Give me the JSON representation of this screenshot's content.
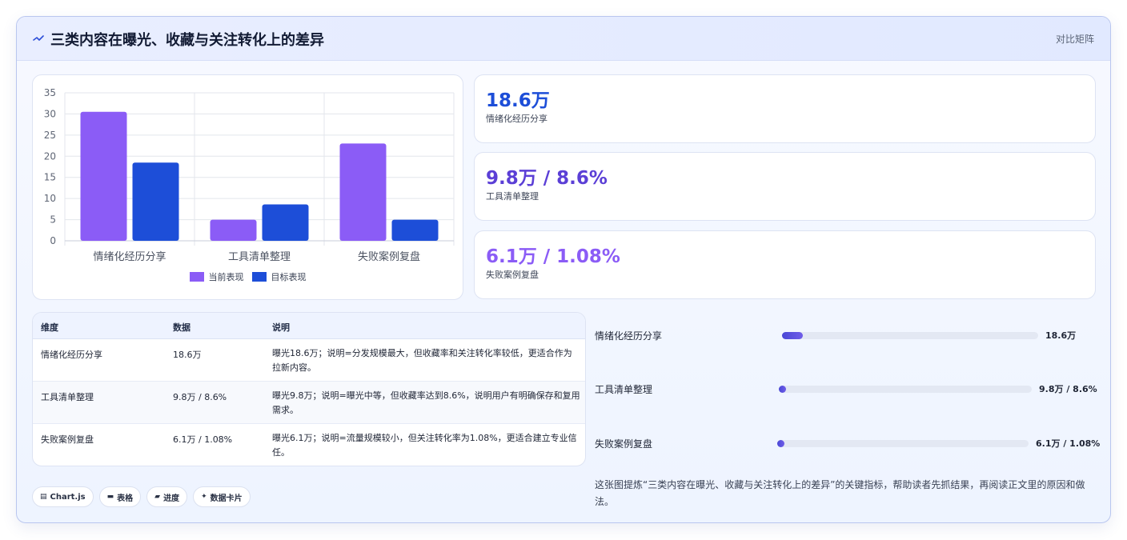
{
  "header": {
    "title": "三类内容在曝光、收藏与关注转化上的差异",
    "right_label": "对比矩阵"
  },
  "colors": {
    "current": "#8b5cf6",
    "target": "#1d4ed8",
    "stat1": "#1d4ed8",
    "stat2": "#5b3fd6",
    "stat3": "#8b5cf6"
  },
  "chart_data": {
    "type": "bar",
    "categories": [
      "情绪化经历分享",
      "工具清单整理",
      "失败案例复盘"
    ],
    "series": [
      {
        "name": "当前表现",
        "values": [
          30.5,
          5,
          23
        ]
      },
      {
        "name": "目标表现",
        "values": [
          18.5,
          8.6,
          5
        ]
      }
    ],
    "ylim": [
      0,
      35
    ],
    "yticks": [
      "0",
      "5",
      "10",
      "15",
      "20",
      "25",
      "30",
      "35"
    ],
    "grid": true,
    "legend": "bottom"
  },
  "stats": [
    {
      "value": "18.6万",
      "label": "情绪化经历分享"
    },
    {
      "value": "9.8万 / 8.6%",
      "label": "工具清单整理"
    },
    {
      "value": "6.1万 / 1.08%",
      "label": "失败案例复盘"
    }
  ],
  "table": {
    "headers": [
      "维度",
      "数据",
      "说明"
    ],
    "rows": [
      {
        "dim": "情绪化经历分享",
        "data": "18.6万",
        "note": "曝光18.6万；说明=分发规模最大，但收藏率和关注转化率较低，更适合作为拉新内容。"
      },
      {
        "dim": "工具清单整理",
        "data": "9.8万 / 8.6%",
        "note": "曝光9.8万；说明=曝光中等，但收藏率达到8.6%，说明用户有明确保存和复用需求。"
      },
      {
        "dim": "失败案例复盘",
        "data": "6.1万 / 1.08%",
        "note": "曝光6.1万；说明=流量规模较小，但关注转化率为1.08%，更适合建立专业信任。"
      }
    ]
  },
  "progress": [
    {
      "label": "情绪化经历分享",
      "value": "18.6万",
      "fraction": 0.08
    },
    {
      "label": "工具清单整理",
      "value": "9.8万 / 8.6%",
      "fraction": 0.03
    },
    {
      "label": "失败案例复盘",
      "value": "6.1万 / 1.08%",
      "fraction": 0.03
    }
  ],
  "chips": [
    {
      "icon": "chart-icon",
      "label": "Chart.js"
    },
    {
      "icon": "table-icon",
      "label": "表格"
    },
    {
      "icon": "progress-icon",
      "label": "进度"
    },
    {
      "icon": "sparkle-icon",
      "label": "数据卡片"
    }
  ],
  "description": "这张图提炼“三类内容在曝光、收藏与关注转化上的差异”的关键指标，帮助读者先抓结果，再阅读正文里的原因和做法。"
}
